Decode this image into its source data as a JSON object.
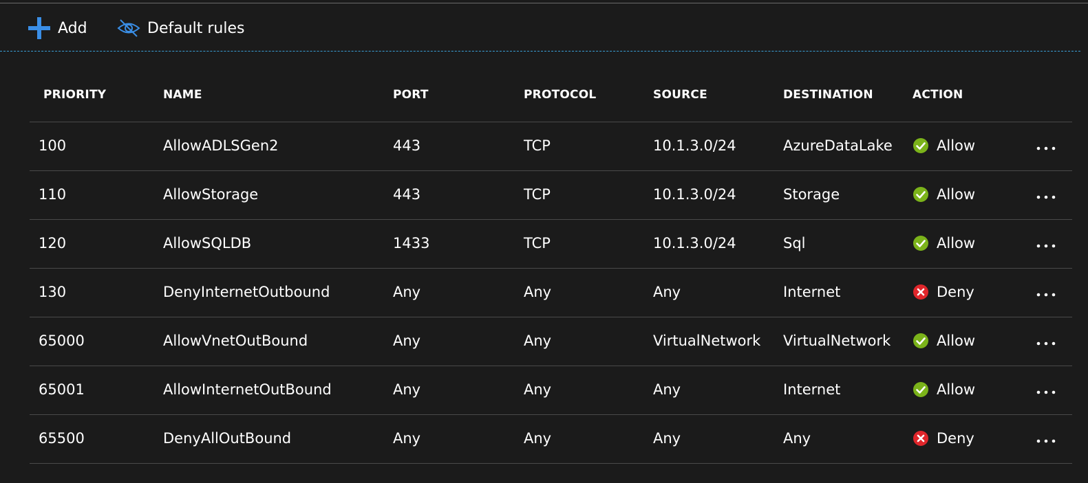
{
  "toolbar": {
    "add_label": "Add",
    "default_rules_label": "Default rules"
  },
  "colors": {
    "accent": "#3a8ee6",
    "allow": "#7bb31a",
    "deny": "#e0262b"
  },
  "table": {
    "headers": [
      "PRIORITY",
      "NAME",
      "PORT",
      "PROTOCOL",
      "SOURCE",
      "DESTINATION",
      "ACTION"
    ],
    "rows": [
      {
        "priority": "100",
        "name": "AllowADLSGen2",
        "port": "443",
        "protocol": "TCP",
        "source": "10.1.3.0/24",
        "destination": "AzureDataLake",
        "action": "Allow",
        "status_icon": "check-circle-icon"
      },
      {
        "priority": "110",
        "name": "AllowStorage",
        "port": "443",
        "protocol": "TCP",
        "source": "10.1.3.0/24",
        "destination": "Storage",
        "action": "Allow",
        "status_icon": "check-circle-icon"
      },
      {
        "priority": "120",
        "name": "AllowSQLDB",
        "port": "1433",
        "protocol": "TCP",
        "source": "10.1.3.0/24",
        "destination": "Sql",
        "action": "Allow",
        "status_icon": "check-circle-icon"
      },
      {
        "priority": "130",
        "name": "DenyInternetOutbound",
        "port": "Any",
        "protocol": "Any",
        "source": "Any",
        "destination": "Internet",
        "action": "Deny",
        "status_icon": "x-circle-icon"
      },
      {
        "priority": "65000",
        "name": "AllowVnetOutBound",
        "port": "Any",
        "protocol": "Any",
        "source": "VirtualNetwork",
        "destination": "VirtualNetwork",
        "action": "Allow",
        "status_icon": "check-circle-icon"
      },
      {
        "priority": "65001",
        "name": "AllowInternetOutBound",
        "port": "Any",
        "protocol": "Any",
        "source": "Any",
        "destination": "Internet",
        "action": "Allow",
        "status_icon": "check-circle-icon"
      },
      {
        "priority": "65500",
        "name": "DenyAllOutBound",
        "port": "Any",
        "protocol": "Any",
        "source": "Any",
        "destination": "Any",
        "action": "Deny",
        "status_icon": "x-circle-icon"
      }
    ]
  }
}
